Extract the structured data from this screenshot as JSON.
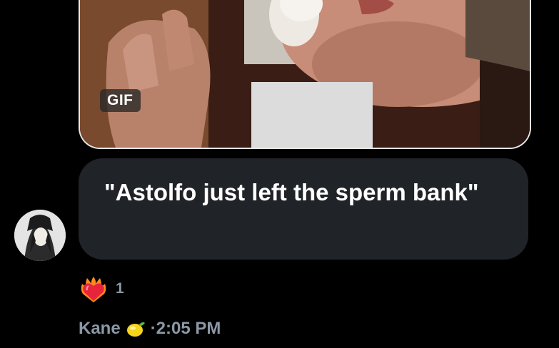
{
  "message": {
    "gif_badge": "GIF",
    "text": "\"Astolfo just left the sperm bank\""
  },
  "reaction": {
    "icon": "heart-on-fire-icon",
    "count": "1"
  },
  "sender": {
    "name": "Kane",
    "name_emoji": "lemon-icon",
    "time": "·2:05 PM"
  },
  "colors": {
    "background": "#000000",
    "bubble": "#202327",
    "meta_text": "#8b98a5"
  }
}
